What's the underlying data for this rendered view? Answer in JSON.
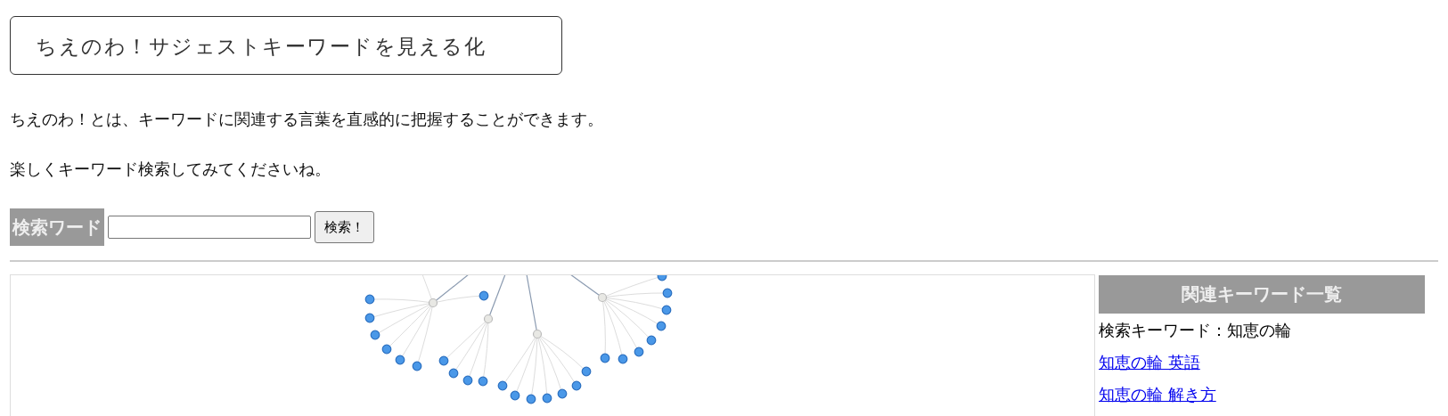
{
  "title": "ちえのわ！サジェストキーワードを見える化",
  "intro": [
    "ちえのわ！とは、キーワードに関連する言葉を直感的に把握することができます。",
    "楽しくキーワード検索してみてくださいね。"
  ],
  "search": {
    "label": "検索ワード",
    "button": "検索！"
  },
  "related": {
    "heading": "関連キーワード一覧",
    "query": "検索キーワード：知恵の輪",
    "links": [
      "知恵の輪 英語",
      "知恵の輪 解き方"
    ]
  }
}
